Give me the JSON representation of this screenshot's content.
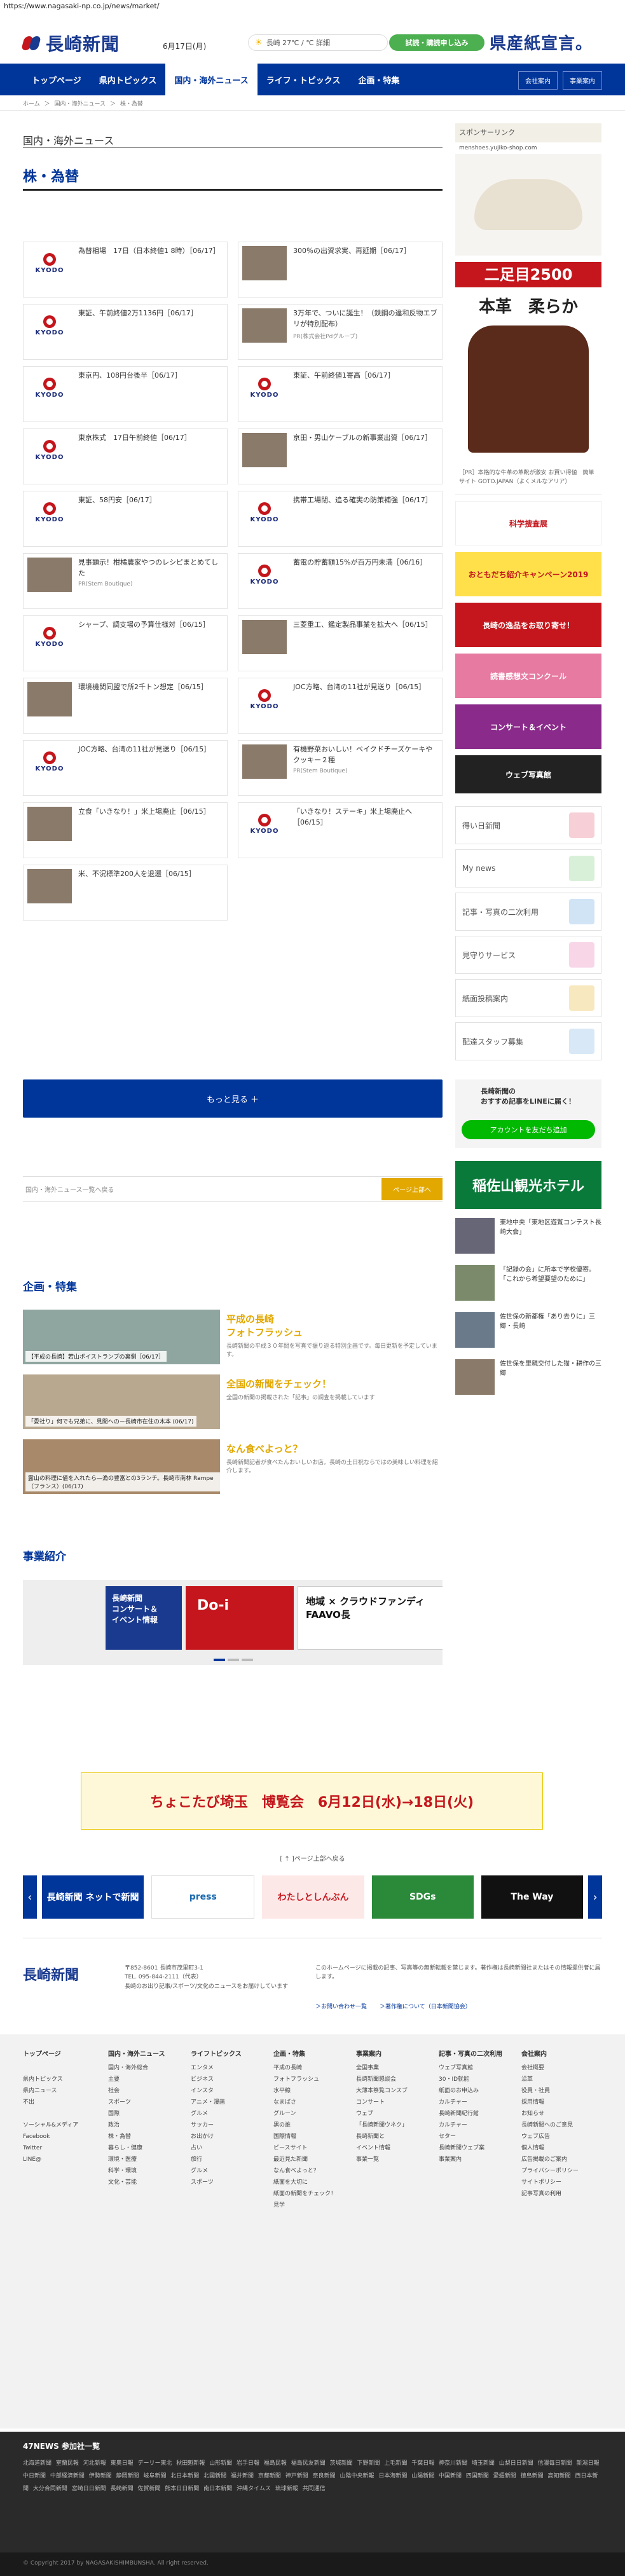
{
  "url": "https://www.nagasaki-np.co.jp/news/market/",
  "header": {
    "logo": "長崎新聞",
    "date": "6月17日(月)",
    "weather": "長崎  27℃ / ℃  詳細",
    "trial_button": "試読・購読申し込み",
    "promo": "県産紙宣言。",
    "nav": [
      "トップページ",
      "県内トピックス",
      "国内・海外ニュース",
      "ライフ・トピックス",
      "企画・特集"
    ],
    "nav_right": [
      "会社案内",
      "事業案内"
    ]
  },
  "breadcrumb": [
    "ホーム",
    "＞",
    "国内・海外ニュース",
    "＞",
    "株・為替"
  ],
  "main": {
    "section": "国内・海外ニュース",
    "title": "株・為替",
    "more_button": "もっと見る ＋",
    "back_link": "国内・海外ニュース一覧へ戻る",
    "top_button": "ページ上部へ"
  },
  "articles": [
    {
      "text": "為替相場　17日（日本終値1 8時）［06/17］",
      "type": "kyodo"
    },
    {
      "text": "300％の出資求実、再延期［06/17］",
      "type": "photo"
    },
    {
      "text": "東証、午前終値2万1136円［06/17］",
      "type": "kyodo"
    },
    {
      "text": "3万年で、ついに誕生！（鉄鋼の違和反物エブリが特別配布）",
      "type": "photo",
      "src": "PR(株式会社Pdグループ)"
    },
    {
      "text": "東京円、108円台後半［06/17］",
      "type": "kyodo"
    },
    {
      "text": "東証、午前終値1寄高［06/17］",
      "type": "kyodo"
    },
    {
      "text": "東京株式　17日午前終値［06/17］",
      "type": "kyodo"
    },
    {
      "text": "京田・男山ケーブルの新事業出資［06/17］",
      "type": "photo"
    },
    {
      "text": "東証、58円安［06/17］",
      "type": "kyodo"
    },
    {
      "text": "携帯工場閉、追る確実の防策補強［06/17］",
      "type": "kyodo"
    },
    {
      "text": "見事顕示！柑橘農家やつのレシピまとめてした",
      "type": "photo",
      "src": "PR(Stem Boutique)"
    },
    {
      "text": "蓄電の貯蓄額15%が百万円未満［06/16］",
      "type": "kyodo"
    },
    {
      "text": "シャープ、調支場の予算仕様対［06/15］",
      "type": "kyodo"
    },
    {
      "text": "三菱重工、鑑定製品事業を拡大へ［06/15］",
      "type": "photo"
    },
    {
      "text": "環境機関同盟で所2千トン想定［06/15］",
      "type": "photo"
    },
    {
      "text": "JOC方略、台湾の11社が見送り［06/15］",
      "type": "kyodo"
    },
    {
      "text": "JOC方略、台湾の11社が見送り［06/15］",
      "type": "kyodo"
    },
    {
      "text": "有機野菜おいしい！ベイクドチーズケーキやクッキー２種",
      "type": "photo",
      "src": "PR(Stem Boutique)"
    },
    {
      "text": "立食「いきなり！」米上場廃止［06/15］",
      "type": "photo"
    },
    {
      "text": "「いきなり！ステーキ」米上場廃止へ［06/15］",
      "type": "kyodo"
    },
    {
      "text": "米、不況標準200人を退還［06/15］",
      "type": "photo"
    }
  ],
  "features": {
    "heading": "企画・特集",
    "items": [
      {
        "caption": "【平成の長崎】若山ボイストランプの裏側［06/17］",
        "title": "平成の長崎\nフォトフラッシュ",
        "desc": "長崎新聞の平成３０年間を写真で振り返る特別企画です。毎日更新を予定しています。"
      },
      {
        "caption": "「愛社り」何でも兄弟に、見聞へのー長崎市在住の木本 (06/17)",
        "title": "全国の新聞をチェック！",
        "desc": "全国の新聞の掲載された「記事」の調査を掲載しています"
      },
      {
        "caption": "露山の料理に値を入れたら―漁の豊富との3ランチ。長崎市南林 Rampe（フランス）(06/17)",
        "title": "なん食べよっと？",
        "desc": "長崎新聞記者が食べたんおいしいお店。長崎の土日祝ならではの美味しい料理を紹介します。"
      }
    ]
  },
  "business": {
    "heading": "事業紹介",
    "b1": "長崎新聞\nコンサート＆\nイベント情報",
    "b2": "Do-i",
    "b3": "地域 × クラウドファンディ\nFAAVO長"
  },
  "sidebar": {
    "sponsor_label": "スポンサーリンク",
    "sponsor_url": "menshoes.yujiko-shop.com",
    "ad_t1": "二足目2500",
    "ad_t2": "本革　柔らか",
    "ad_note": "［PR］本格的な牛革の革靴が激安 お買い得値　簡単サイト GOTO.JAPAN（よくメルなアリア）",
    "banners": [
      "科学捜査展",
      "おともだち紹介キャンペーン2019",
      "長崎の逸品をお取り寄せ！",
      "読書感想文コンクール",
      "コンサート＆イベント",
      "ウェブ写真館"
    ],
    "buttons": [
      "得い日新聞",
      "My news",
      "記事・写真の二次利用",
      "見守りサービス",
      "紙面投稿案内",
      "配達スタッフ募集"
    ],
    "line_title": "長崎新聞の\nおすすめ記事をLINEに届く！",
    "line_button": "アカウントを友だち追加",
    "hotel": "稲佐山観光ホテル",
    "small": [
      "東地中央「東地区遊覧コンテスト長崎大会」",
      "「記録の会」に所本で学校優寄。「これから希望要望のために」",
      "佐世保の新都権「あり去りに」三郷・長崎",
      "佐世保を里親交付した猫・耕作の三郷"
    ]
  },
  "bottom_ad": "ちょこたび埼玉　博覧会　6月12日(水)→18日(火)",
  "prev_page": "[ ↑ ]ページ上部へ戻る",
  "carousel": [
    "長崎新聞 ネットで新聞",
    "press",
    "わたしとしんぶん",
    "SDGs",
    "The Way"
  ],
  "footer": {
    "logo": "長崎新聞",
    "address": "〒852-8601 長崎市茂里町3-1\nTEL. 095-844-2111（代表）\n長崎のお出り記事/スポーツ/文化のニュースをお届けしています",
    "note": "このホームページに掲載の記事、写真等の無断転載を禁じます。著作権は長崎新聞社またはその情報提供者に属します。",
    "links": [
      "＞お問い合わせ一覧",
      "＞著作権について（日本新聞協会）"
    ]
  },
  "sitemap": [
    {
      "h": "トップページ",
      "items": [
        "",
        "県内トピックス",
        "県内ニュース",
        "不出",
        "",
        "ソーシャル&メディア",
        "Facebook",
        "Twitter",
        "LINE@"
      ]
    },
    {
      "h": "国内・海外ニュース",
      "items": [
        "国内・海外総合",
        "主要",
        "社会",
        "スポーツ",
        "国際",
        "政治",
        "株・為替",
        "暮らし・健康",
        "環境・医療",
        "科学・環境",
        "文化・芸能"
      ]
    },
    {
      "h": "ライフトピックス",
      "items": [
        "エンタメ",
        "ビジネス",
        "インスタ",
        "アニメ・漫画",
        "グルメ",
        "サッカー",
        "お出かけ",
        "占い",
        "旅行",
        "グルメ",
        "スポーツ"
      ]
    },
    {
      "h": "企画・特集",
      "items": [
        "平成の長崎",
        "フォトフラッシュ",
        "水平線",
        "なまばさ",
        "グルーン",
        "黒の誰",
        "国際情報",
        "ピースサイト",
        "最近見た新聞",
        "なん食べよっと？",
        "紙面を大切に",
        "紙面の新聞をチェック！",
        "見学"
      ]
    },
    {
      "h": "事業案内",
      "items": [
        "全国事業",
        "長崎新聞懇談会",
        "大薄本祭覧コンスブ",
        "コンサート",
        "ウェブ",
        "「長崎新聞ウネク」",
        "長崎新聞と",
        "イベント情報",
        "事業一覧"
      ]
    },
    {
      "h": "記事・写真の二次利用",
      "items": [
        "ウェブ写真館",
        "30・ID就能",
        "紙面のお申込み",
        "カルチャー",
        "長崎新聞紀行館",
        "カルチャー",
        "セター",
        "長崎新聞ウェブ案",
        "事業案内"
      ]
    },
    {
      "h": "会社案内",
      "items": [
        "会社概要",
        "沿革",
        "役員・社員",
        "採用情報",
        "お知らせ",
        "長崎新聞へのご意見",
        "ウェブ広告",
        "個人情報",
        "広告掲載のご案内",
        "プライバシーポリシー",
        "サイトポリシー",
        "記事写真の利用"
      ]
    }
  ],
  "news47": {
    "heading": "47NEWS 参加社一覧",
    "links": "北海道新聞 室蘭民報 河北新報 東奥日報 デーリー東北 秋田魁新報 山形新聞 岩手日報 福島民報 福島民友新聞 茨城新聞 下野新聞 上毛新聞 千葉日報 神奈川新聞 埼玉新聞 山梨日日新聞 信濃毎日新聞 新潟日報 中日新聞 中部経済新聞 伊勢新聞 静岡新聞 岐阜新聞 北日本新聞 北國新聞 福井新聞 京都新聞 神戸新聞 奈良新聞 山陰中央新報 日本海新聞 山陽新聞 中国新聞 四国新聞 愛媛新聞 徳島新聞 高知新聞 西日本新聞 大分合同新聞 宮崎日日新聞 長崎新聞 佐賀新聞 熊本日日新聞 南日本新聞 沖縄タイムス 琉球新報 共同通信"
  },
  "copyright": "© Copyright 2017 by NAGASAKISHIMBUNSHA. All right reserved."
}
